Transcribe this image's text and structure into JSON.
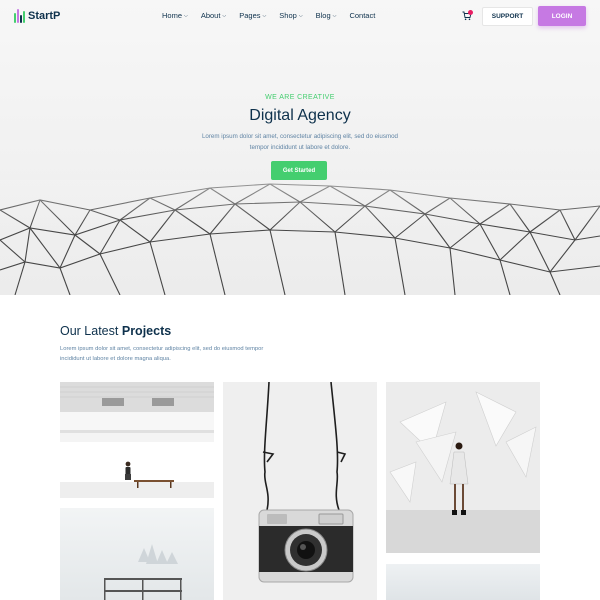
{
  "brand": {
    "name": "StartP",
    "colors": {
      "green": "#44ce6f",
      "purple": "#c679e3",
      "navy": "#0e314c",
      "muted": "#6084a4",
      "badge": "#e91e63"
    }
  },
  "nav": {
    "items": [
      {
        "label": "Home",
        "has_dropdown": true
      },
      {
        "label": "About",
        "has_dropdown": true
      },
      {
        "label": "Pages",
        "has_dropdown": true
      },
      {
        "label": "Shop",
        "has_dropdown": true
      },
      {
        "label": "Blog",
        "has_dropdown": true
      },
      {
        "label": "Contact",
        "has_dropdown": false
      }
    ],
    "cart_icon": "shopping-cart-icon",
    "support_label": "SUPPORT",
    "login_label": "LOGIN"
  },
  "hero": {
    "eyebrow": "WE ARE CREATIVE",
    "title": "Digital Agency",
    "description": "Lorem ipsum dolor sit amet, consectetur adipiscing elit, sed do eiusmod tempor incididunt ut labore et dolore.",
    "button_label": "Get Started"
  },
  "projects": {
    "title_prefix": "Our Latest",
    "title_bold": "Projects",
    "description": "Lorem ipsum dolor sit amet, consectetur adipiscing elit, sed do eiusmod tempor incididunt ut labore et dolore magna aliqua."
  }
}
